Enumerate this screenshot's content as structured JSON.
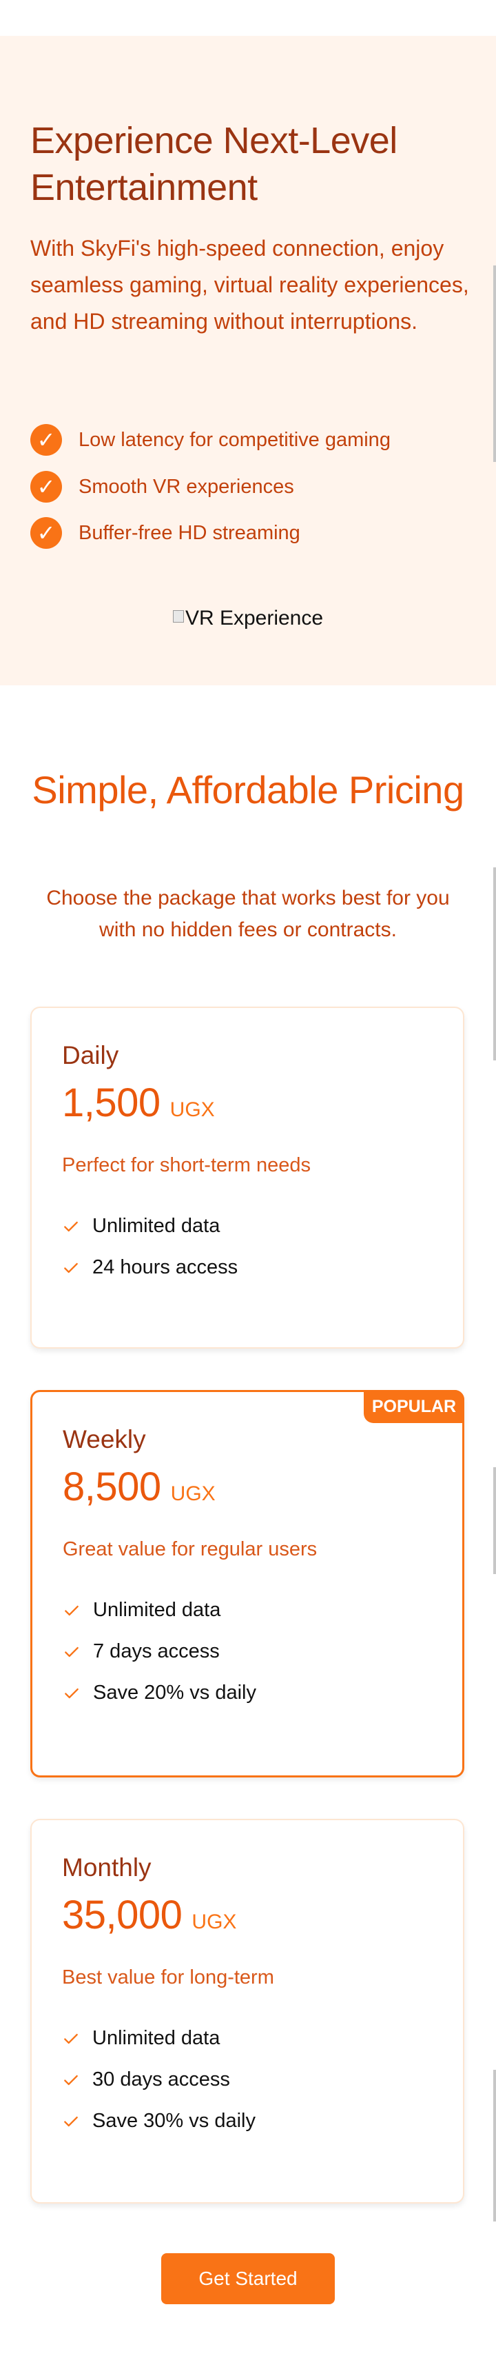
{
  "hero": {
    "title": "Experience Next-Level Entertainment",
    "description": "With SkyFi's high-speed connection, enjoy seamless gaming, virtual reality experiences, and HD streaming without interruptions.",
    "features": [
      "Low latency for competitive gaming",
      "Smooth VR experiences",
      "Buffer-free HD streaming"
    ],
    "image_alt": "VR Experience"
  },
  "pricing": {
    "title": "Simple, Affordable Pricing",
    "subtitle": "Choose the package that works best for you with no hidden fees or contracts.",
    "plans": [
      {
        "name": "Daily",
        "price": "1,500",
        "currency": "UGX",
        "description": "Perfect for short-term needs",
        "features": [
          "Unlimited data",
          "24 hours access"
        ]
      },
      {
        "name": "Weekly",
        "price": "8,500",
        "currency": "UGX",
        "badge": "POPULAR",
        "description": "Great value for regular users",
        "features": [
          "Unlimited data",
          "7 days access",
          "Save 20% vs daily"
        ]
      },
      {
        "name": "Monthly",
        "price": "35,000",
        "currency": "UGX",
        "description": "Best value for long-term",
        "features": [
          "Unlimited data",
          "30 days access",
          "Save 30% vs daily"
        ]
      }
    ],
    "cta_label": "Get Started"
  },
  "icons": {
    "feature_check": "check-circle-icon",
    "plan_check": "check-icon"
  },
  "colors": {
    "accent": "#f97316",
    "accent_dark": "#ea580c",
    "heading": "#9a3412",
    "text_orange": "#c2410c",
    "hero_background": "#fff4ec"
  }
}
